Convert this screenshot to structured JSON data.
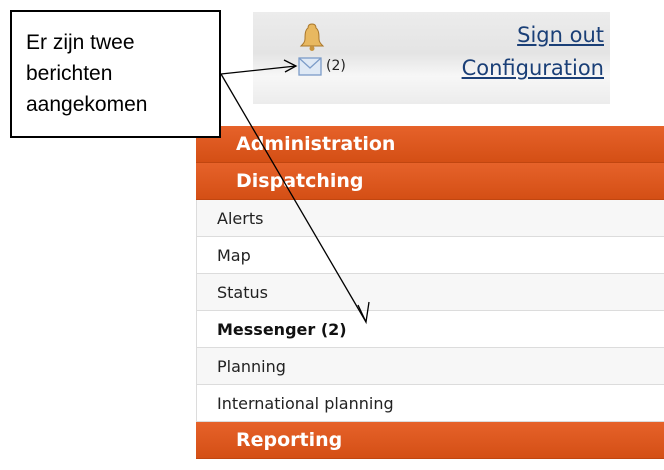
{
  "header": {
    "message_count": "(2)",
    "sign_out_label": "Sign out",
    "configuration_label": "Configuration"
  },
  "callout": {
    "text": "Er zijn twee\nberichten\naangekomen"
  },
  "menu": {
    "sections": [
      {
        "label": "Administration"
      },
      {
        "label": "Dispatching"
      }
    ],
    "items": [
      {
        "label": "Alerts"
      },
      {
        "label": "Map"
      },
      {
        "label": "Status"
      },
      {
        "label": "Messenger (2)"
      },
      {
        "label": "Planning"
      },
      {
        "label": "International planning"
      }
    ],
    "footer_section": {
      "label": "Reporting"
    }
  },
  "colors": {
    "section_orange": "#e05a20",
    "link_blue": "#1a3f77"
  },
  "icons": [
    "bell-icon",
    "envelope-icon"
  ]
}
